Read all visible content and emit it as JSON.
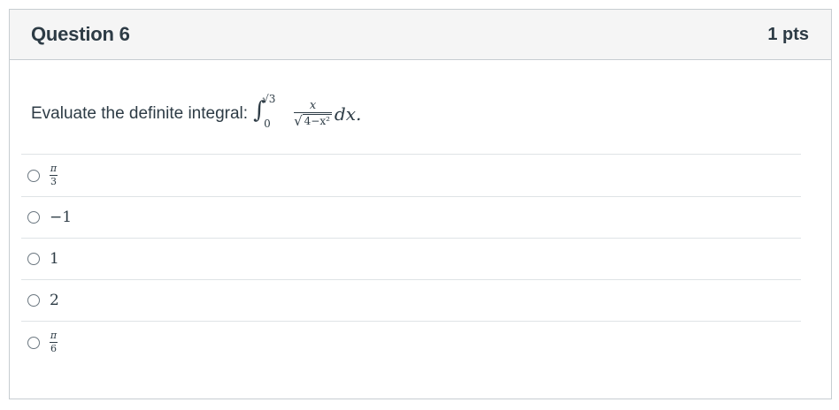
{
  "question": {
    "title": "Question 6",
    "points": "1 pts",
    "prompt": "Evaluate the definite integral:",
    "math": {
      "integral_sign": "∫",
      "upper_limit": "√3",
      "lower_limit": "0",
      "numerator": "x",
      "denominator_radical": "√",
      "denominator_radicand": "4−x²",
      "differential": "dx."
    }
  },
  "answers": [
    {
      "type": "fraction",
      "numerator": "π",
      "denominator": "3"
    },
    {
      "type": "text",
      "text": "−1"
    },
    {
      "type": "text",
      "text": "1"
    },
    {
      "type": "text",
      "text": "2"
    },
    {
      "type": "fraction",
      "numerator": "π",
      "denominator": "6"
    }
  ]
}
